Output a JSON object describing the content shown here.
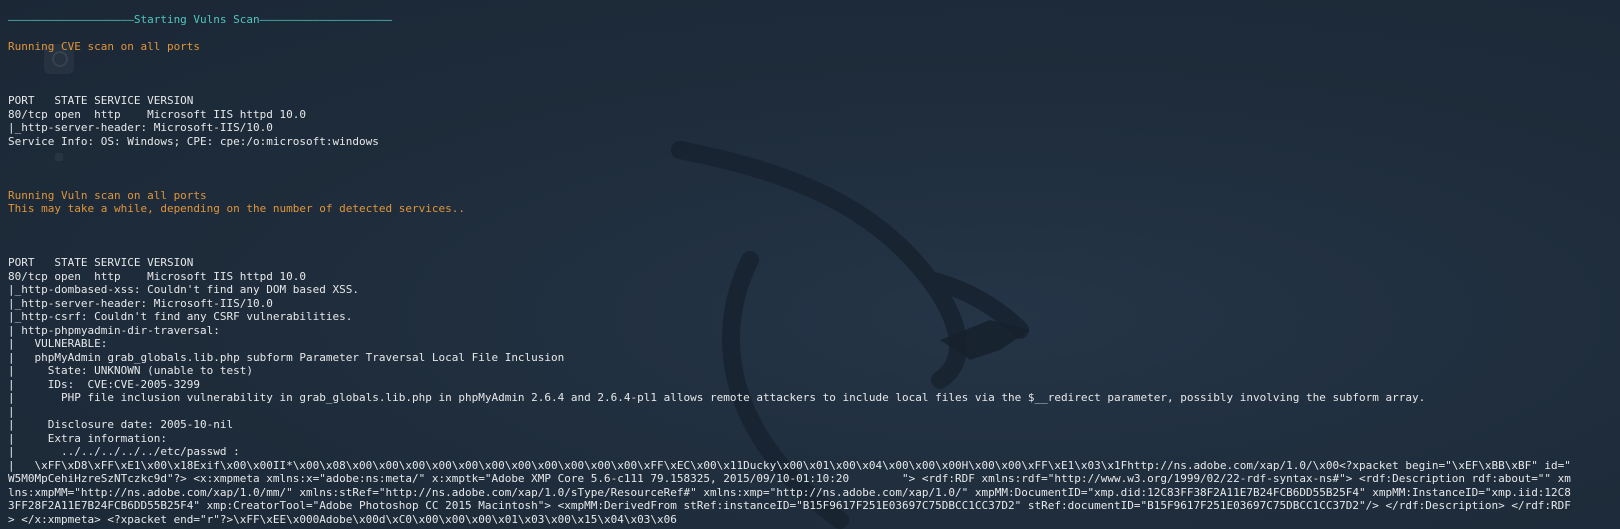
{
  "colors": {
    "background": "#1e2b3a",
    "heading": "#4fc7c0",
    "status": "#e0953a",
    "output": "#e6e8ea"
  },
  "terminal": {
    "lines": [
      {
        "text": "———————————————————Starting Vulns Scan————————————————————",
        "style": "teal"
      },
      {
        "text": "",
        "style": "white"
      },
      {
        "text": "Running CVE scan on all ports",
        "style": "orange"
      },
      {
        "text": "",
        "style": "white"
      },
      {
        "text": "",
        "style": "white"
      },
      {
        "text": "",
        "style": "white"
      },
      {
        "text": "PORT   STATE SERVICE VERSION",
        "style": "white"
      },
      {
        "text": "80/tcp open  http    Microsoft IIS httpd 10.0",
        "style": "white"
      },
      {
        "text": "|_http-server-header: Microsoft-IIS/10.0",
        "style": "white"
      },
      {
        "text": "Service Info: OS: Windows; CPE: cpe:/o:microsoft:windows",
        "style": "white"
      },
      {
        "text": "",
        "style": "white"
      },
      {
        "text": "",
        "style": "white"
      },
      {
        "text": "",
        "style": "white"
      },
      {
        "text": "Running Vuln scan on all ports",
        "style": "orange"
      },
      {
        "text": "This may take a while, depending on the number of detected services..",
        "style": "orange"
      },
      {
        "text": "",
        "style": "white"
      },
      {
        "text": "",
        "style": "white"
      },
      {
        "text": "",
        "style": "white"
      },
      {
        "text": "PORT   STATE SERVICE VERSION",
        "style": "white"
      },
      {
        "text": "80/tcp open  http    Microsoft IIS httpd 10.0",
        "style": "white"
      },
      {
        "text": "|_http-dombased-xss: Couldn't find any DOM based XSS.",
        "style": "white"
      },
      {
        "text": "|_http-server-header: Microsoft-IIS/10.0",
        "style": "white"
      },
      {
        "text": "|_http-csrf: Couldn't find any CSRF vulnerabilities.",
        "style": "white"
      },
      {
        "text": "| http-phpmyadmin-dir-traversal:",
        "style": "white"
      },
      {
        "text": "|   VULNERABLE:",
        "style": "white"
      },
      {
        "text": "|   phpMyAdmin grab_globals.lib.php subform Parameter Traversal Local File Inclusion",
        "style": "white"
      },
      {
        "text": "|     State: UNKNOWN (unable to test)",
        "style": "white"
      },
      {
        "text": "|     IDs:  CVE:CVE-2005-3299",
        "style": "white"
      },
      {
        "text": "|       PHP file inclusion vulnerability in grab_globals.lib.php in phpMyAdmin 2.6.4 and 2.6.4-pl1 allows remote attackers to include local files via the $__redirect parameter, possibly involving the subform array.",
        "style": "white"
      },
      {
        "text": "|",
        "style": "white"
      },
      {
        "text": "|     Disclosure date: 2005-10-nil",
        "style": "white"
      },
      {
        "text": "|     Extra information:",
        "style": "white"
      },
      {
        "text": "|       ../../../../../etc/passwd :",
        "style": "white"
      },
      {
        "text": "|   \\xFF\\xD8\\xFF\\xE1\\x00\\x18Exif\\x00\\x00II*\\x00\\x08\\x00\\x00\\x00\\x00\\x00\\x00\\x00\\x00\\x00\\x00\\x00\\xFF\\xEC\\x00\\x11Ducky\\x00\\x01\\x00\\x04\\x00\\x00\\x00H\\x00\\x00\\xFF\\xE1\\x03\\x1Fhttp://ns.adobe.com/xap/1.0/\\x00<?xpacket begin=\"\\xEF\\xBB\\xBF\" id=\"",
        "style": "white"
      },
      {
        "text": "W5M0MpCehiHzreSzNTczkc9d\"?> <x:xmpmeta xmlns:x=\"adobe:ns:meta/\" x:xmptk=\"Adobe XMP Core 5.6-c111 79.158325, 2015/09/10-01:10:20        \"> <rdf:RDF xmlns:rdf=\"http://www.w3.org/1999/02/22-rdf-syntax-ns#\"> <rdf:Description rdf:about=\"\" xm",
        "style": "white"
      },
      {
        "text": "lns:xmpMM=\"http://ns.adobe.com/xap/1.0/mm/\" xmlns:stRef=\"http://ns.adobe.com/xap/1.0/sType/ResourceRef#\" xmlns:xmp=\"http://ns.adobe.com/xap/1.0/\" xmpMM:DocumentID=\"xmp.did:12C83FF38F2A11E7B24FCB6DD55B25F4\" xmpMM:InstanceID=\"xmp.iid:12C8",
        "style": "white"
      },
      {
        "text": "3FF28F2A11E7B24FCB6DD55B25F4\" xmp:CreatorTool=\"Adobe Photoshop CC 2015 Macintosh\"> <xmpMM:DerivedFrom stRef:instanceID=\"B15F9617F251E03697C75DBCC1CC37D2\" stRef:documentID=\"B15F9617F251E03697C75DBCC1CC37D2\"/> </rdf:Description> </rdf:RDF",
        "style": "white"
      },
      {
        "text": "> </x:xmpmeta> <?xpacket end=\"r\"?>\\xFF\\xEE\\x000Adobe\\x00d\\xC0\\x00\\x00\\x00\\x01\\x03\\x00\\x15\\x04\\x03\\x06",
        "style": "white"
      }
    ]
  }
}
